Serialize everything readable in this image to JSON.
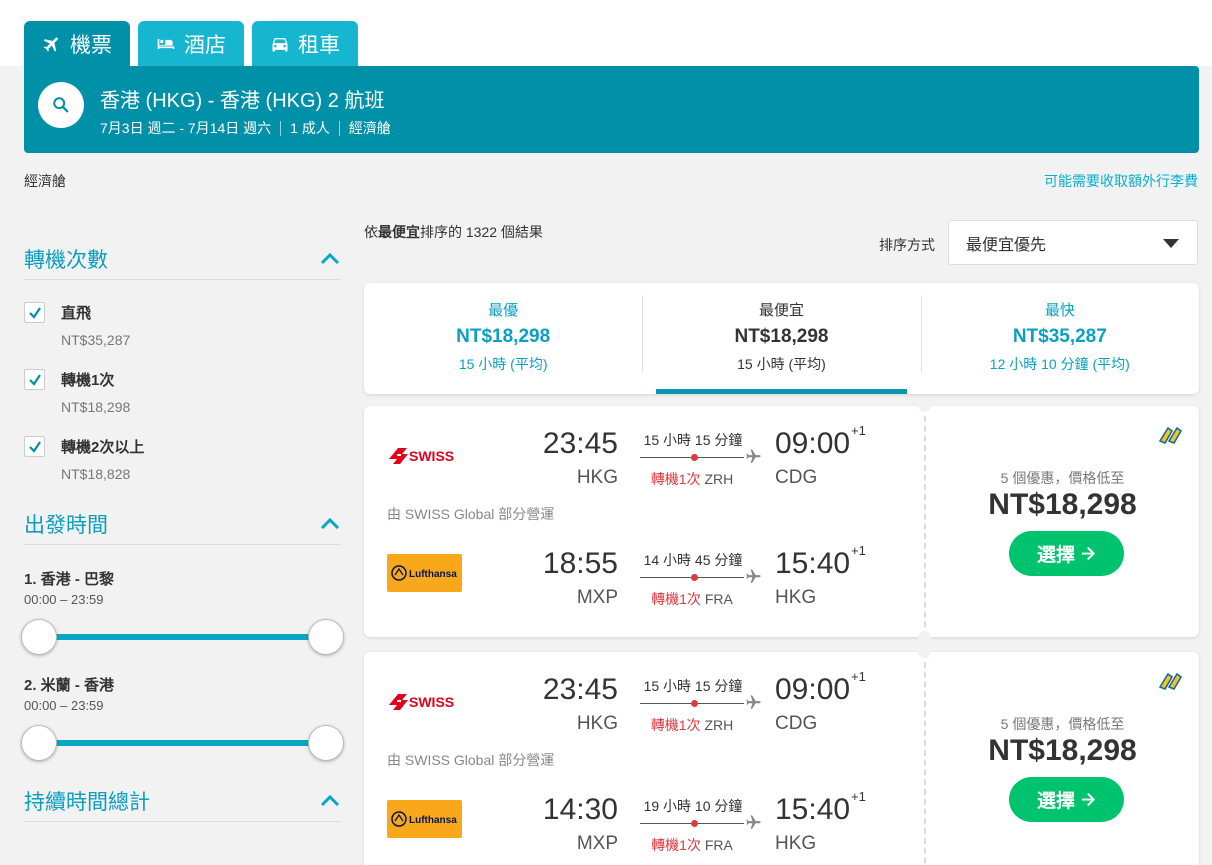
{
  "tabs": [
    {
      "label": "機票",
      "icon": "airplane-icon",
      "active": true
    },
    {
      "label": "酒店",
      "icon": "bed-icon",
      "active": false
    },
    {
      "label": "租車",
      "icon": "car-icon",
      "active": false
    }
  ],
  "search": {
    "route": "香港 (HKG) - 香港 (HKG) 2 航班",
    "dates": "7月3日 週二 - 7月14日 週六",
    "passengers": "1 成人",
    "cabin": "經濟艙"
  },
  "cabin_label": "經濟艙",
  "baggage_link": "可能需要收取額外行李費",
  "filters": {
    "stops": {
      "title": "轉機次數",
      "options": [
        {
          "label": "直飛",
          "price": "NT$35,287",
          "checked": true
        },
        {
          "label": "轉機1次",
          "price": "NT$18,298",
          "checked": true
        },
        {
          "label": "轉機2次以上",
          "price": "NT$18,828",
          "checked": true
        }
      ]
    },
    "departure": {
      "title": "出發時間",
      "sliders": [
        {
          "label": "1. 香港 - 巴黎",
          "range": "00:00 – 23:59"
        },
        {
          "label": "2. 米蘭 - 香港",
          "range": "00:00 – 23:59"
        }
      ]
    },
    "duration": {
      "title": "持續時間總計"
    }
  },
  "results": {
    "prefix": "依",
    "sort_bold": "最便宜",
    "suffix": "排序的 1322 個結果"
  },
  "sort": {
    "label": "排序方式",
    "value": "最便宜優先"
  },
  "sort_tabs": [
    {
      "title": "最優",
      "price": "NT$18,298",
      "duration": "15 小時 (平均)",
      "selected": false
    },
    {
      "title": "最便宜",
      "price": "NT$18,298",
      "duration": "15 小時 (平均)",
      "selected": true
    },
    {
      "title": "最快",
      "price": "NT$35,287",
      "duration": "12 小時 10 分鐘 (平均)",
      "selected": false
    }
  ],
  "flights": [
    {
      "operated_by": "由 SWISS Global 部分營運",
      "deals": "5 個優惠，價格低至",
      "price": "NT$18,298",
      "select_label": "選擇",
      "legs": [
        {
          "airline": "SWISS",
          "dep_time": "23:45",
          "dep_code": "HKG",
          "duration": "15 小時 15 分鐘",
          "stops": "轉機1次",
          "via": "ZRH",
          "arr_time": "09:00",
          "arr_code": "CDG",
          "day_offset": "+1"
        },
        {
          "airline": "Lufthansa",
          "dep_time": "18:55",
          "dep_code": "MXP",
          "duration": "14 小時 45 分鐘",
          "stops": "轉機1次",
          "via": "FRA",
          "arr_time": "15:40",
          "arr_code": "HKG",
          "day_offset": "+1"
        }
      ]
    },
    {
      "operated_by": "由 SWISS Global 部分營運",
      "deals": "5 個優惠，價格低至",
      "price": "NT$18,298",
      "select_label": "選擇",
      "legs": [
        {
          "airline": "SWISS",
          "dep_time": "23:45",
          "dep_code": "HKG",
          "duration": "15 小時 15 分鐘",
          "stops": "轉機1次",
          "via": "ZRH",
          "arr_time": "09:00",
          "arr_code": "CDG",
          "day_offset": "+1"
        },
        {
          "airline": "Lufthansa",
          "dep_time": "14:30",
          "dep_code": "MXP",
          "duration": "19 小時 10 分鐘",
          "stops": "轉機1次",
          "via": "FRA",
          "arr_time": "15:40",
          "arr_code": "HKG",
          "day_offset": "+1"
        }
      ]
    }
  ],
  "colors": {
    "brand": "#0090a8",
    "accent": "#07b0cd",
    "cta": "#00c36e",
    "stop_red": "#e0393e"
  }
}
